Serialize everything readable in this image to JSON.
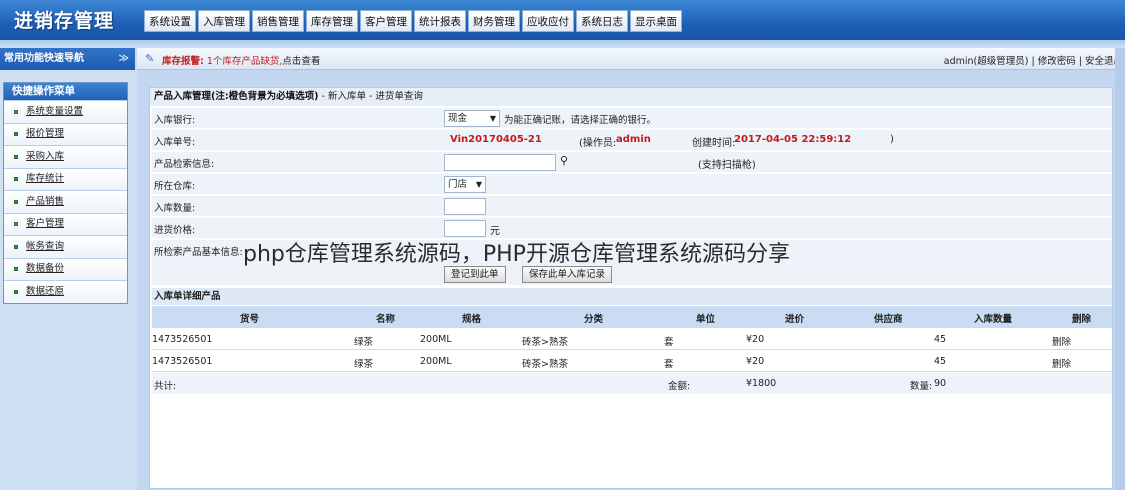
{
  "app": {
    "title": "进销存管理"
  },
  "menu": {
    "tabs": [
      "系统设置",
      "入库管理",
      "销售管理",
      "库存管理",
      "客户管理",
      "统计报表",
      "财务管理",
      "应收应付",
      "系统日志",
      "显示桌面"
    ]
  },
  "sidebar": {
    "header": "常用功能快速导航",
    "collapse_glyph": "≫",
    "quick_menu_title": "快捷操作菜单",
    "items": [
      {
        "label": "系统变量设置"
      },
      {
        "label": "报价管理"
      },
      {
        "label": "采购入库"
      },
      {
        "label": "库存统计"
      },
      {
        "label": "产品销售"
      },
      {
        "label": "客户管理"
      },
      {
        "label": "帐务查询"
      },
      {
        "label": "数据备份"
      },
      {
        "label": "数据还原"
      }
    ]
  },
  "status": {
    "alert_label": "库存报警:",
    "alert_msg": "1个库存产品缺货,",
    "alert_link": "点击查看",
    "user": "admin(超级管理员)",
    "sep1": " | ",
    "change_password": "修改密码",
    "sep2": " | ",
    "logout": "安全退出"
  },
  "panel": {
    "title_bold": "产品入库管理(注:橙色背景为必填选项)",
    "title_rest": " - 新入库单 - 进货单查询"
  },
  "form": {
    "bank_label": "入库银行:",
    "bank_value": "现金",
    "bank_hint": "为能正确记账，请选择正确的银行。",
    "order_label": "入库单号:",
    "order_no": "Vin20170405-21",
    "operator_prefix": "(操作员:",
    "operator": "admin",
    "created_prefix": "创建时间:",
    "created_time": "2017-04-05 22:59:12",
    "close_paren": ")",
    "search_label": "产品检索信息:",
    "search_value": "",
    "scan_hint": "(支持扫描枪)",
    "warehouse_label": "所在仓库:",
    "warehouse_value": "门店",
    "qty_label": "入库数量:",
    "qty_value": "",
    "price_label": "进货价格:",
    "price_value": "",
    "price_unit": "元",
    "info_label": "所检索产品基本信息:",
    "register_button": "登记到此单",
    "save_button": "保存此单入库记录"
  },
  "detail": {
    "title": "入库单详细产品",
    "columns": [
      "货号",
      "名称",
      "规格",
      "分类",
      "单位",
      "进价",
      "供应商",
      "入库数量",
      "删除"
    ],
    "rows": [
      {
        "sku": "1473526501",
        "name": "绿茶",
        "spec": "200ML",
        "category": "砖茶>熟茶",
        "unit": "套",
        "price": "¥20",
        "supplier": "",
        "qty": "45",
        "delete": "删除"
      },
      {
        "sku": "1473526501",
        "name": "绿茶",
        "spec": "200ML",
        "category": "砖茶>熟茶",
        "unit": "套",
        "price": "¥20",
        "supplier": "",
        "qty": "45",
        "delete": "删除"
      }
    ],
    "summary": {
      "label": "共计:",
      "amount_label": "金额:",
      "amount": "¥1800",
      "qty_label": "数量:",
      "qty": "90"
    }
  },
  "watermark": "php仓库管理系统源码，PHP开源仓库管理系统源码分享"
}
